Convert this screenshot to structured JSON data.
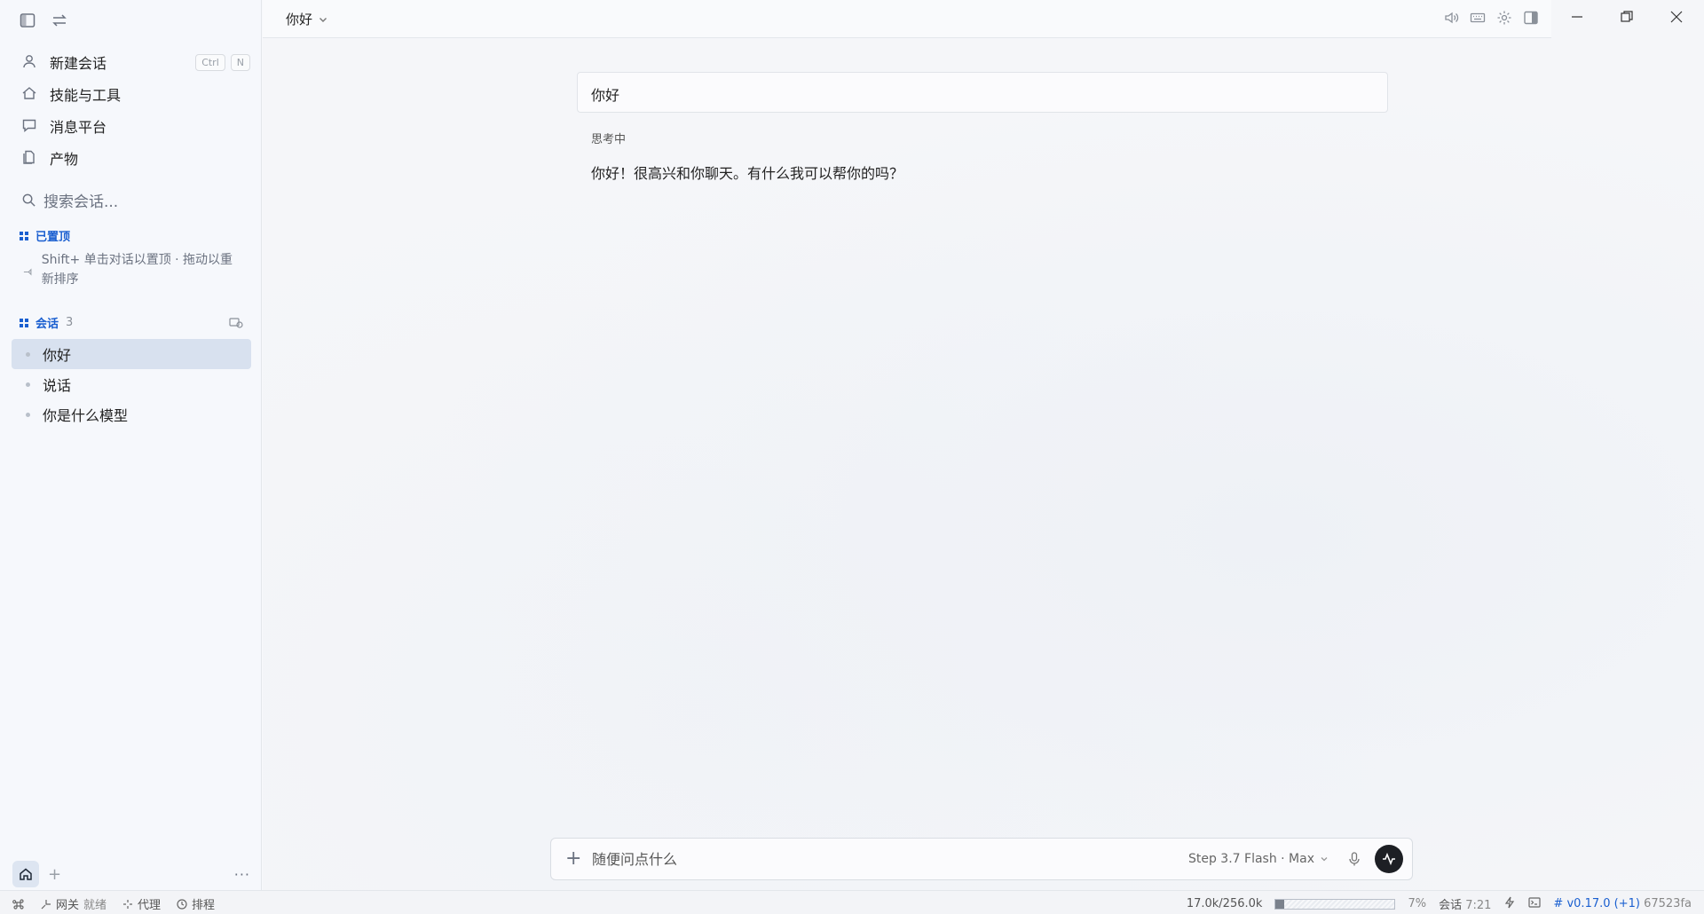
{
  "sidebar": {
    "nav": [
      {
        "label": "新建会话",
        "icon": "new-chat-icon"
      },
      {
        "label": "技能与工具",
        "icon": "tools-icon"
      },
      {
        "label": "消息平台",
        "icon": "message-icon"
      },
      {
        "label": "产物",
        "icon": "artifact-icon"
      }
    ],
    "shortcut": [
      "Ctrl",
      "N"
    ],
    "search_placeholder": "搜索会话...",
    "pinned": {
      "title": "已置顶",
      "hint": "Shift+ 单击对话以置顶 · 拖动以重新排序"
    },
    "conversations": {
      "title": "会话",
      "count": "3",
      "items": [
        "你好",
        "说话",
        "你是什么模型"
      ]
    },
    "more_label": "···"
  },
  "main": {
    "title": "你好",
    "user_message": "你好",
    "thinking_label": "思考中",
    "assistant_message": "你好！很高兴和你聊天。有什么我可以帮你的吗？",
    "composer": {
      "placeholder": "随便问点什么",
      "model": "Step 3.7 Flash · Max"
    }
  },
  "statusbar": {
    "gateway_label": "网关",
    "gateway_status": "就绪",
    "proxy": "代理",
    "schedule": "排程",
    "tokens": "17.0k/256.0k",
    "context_percent": 7,
    "context_percent_label": "7%",
    "session_label": "会话",
    "session_time": "7:21",
    "version": "v0.17.0 (+1)",
    "commit": "67523fa"
  },
  "colors": {
    "accent": "#1a5fd0",
    "active_row": "#d8e1ef",
    "send_button": "#1d1f24"
  }
}
